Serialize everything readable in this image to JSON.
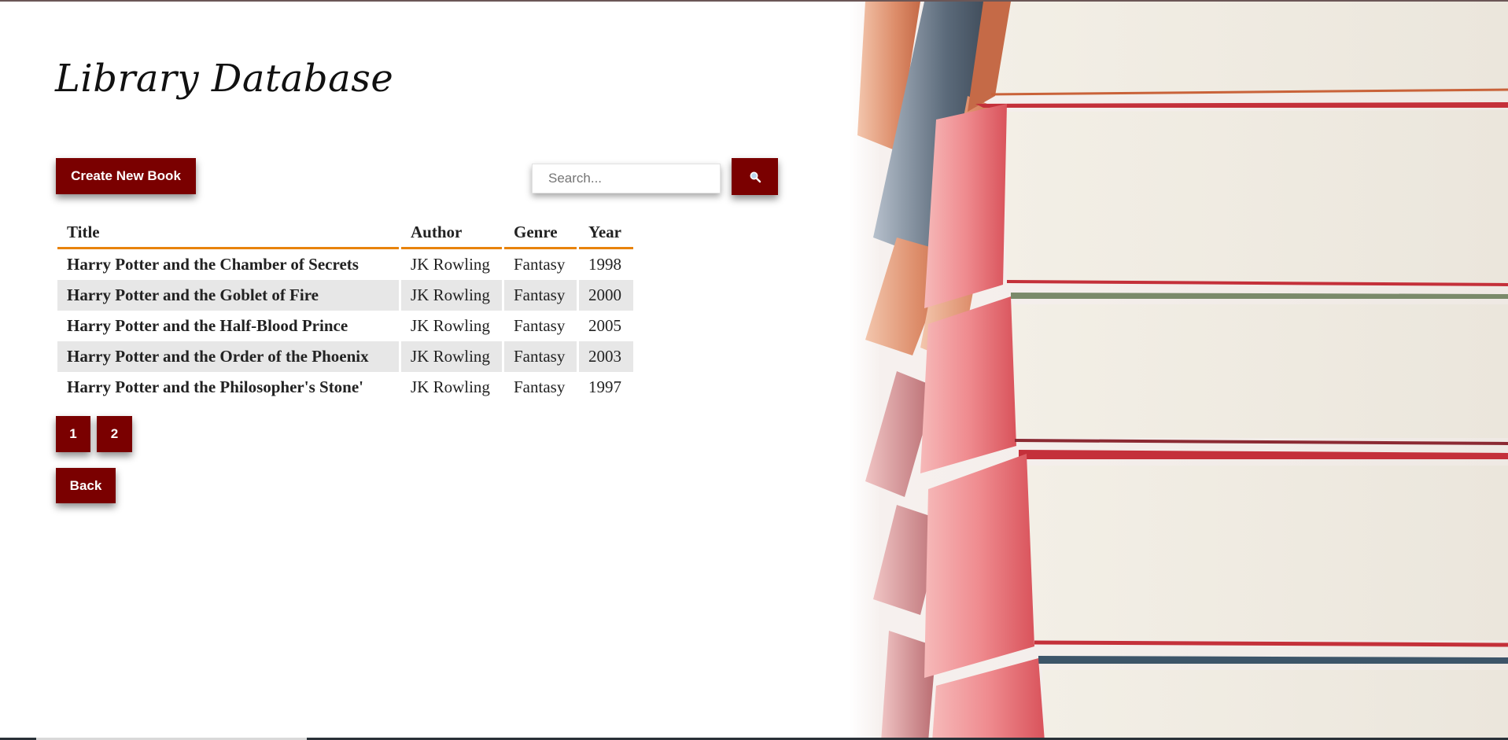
{
  "page": {
    "title": "Library Database"
  },
  "toolbar": {
    "create_label": "Create New Book",
    "search_placeholder": "Search...",
    "search_value": ""
  },
  "table": {
    "headers": {
      "title": "Title",
      "author": "Author",
      "genre": "Genre",
      "year": "Year"
    },
    "rows": [
      {
        "title": "Harry Potter and the Chamber of Secrets",
        "author": "JK Rowling",
        "genre": "Fantasy",
        "year": "1998"
      },
      {
        "title": "Harry Potter and the Goblet of Fire",
        "author": "JK Rowling",
        "genre": "Fantasy",
        "year": "2000"
      },
      {
        "title": "Harry Potter and the Half-Blood Prince",
        "author": "JK Rowling",
        "genre": "Fantasy",
        "year": "2005"
      },
      {
        "title": "Harry Potter and the Order of the Phoenix",
        "author": "JK Rowling",
        "genre": "Fantasy",
        "year": "2003"
      },
      {
        "title": "Harry Potter and the Philosopher's Stone'",
        "author": "JK Rowling",
        "genre": "Fantasy",
        "year": "1997"
      }
    ]
  },
  "pagination": {
    "pages": [
      "1",
      "2"
    ]
  },
  "navigation": {
    "back_label": "Back"
  },
  "icons": {
    "search": "search-icon"
  },
  "colors": {
    "button_bg": "#7a0000",
    "button_text": "#ffffff",
    "header_underline": "#e8830c",
    "alt_row_bg": "#e7e7e7"
  }
}
